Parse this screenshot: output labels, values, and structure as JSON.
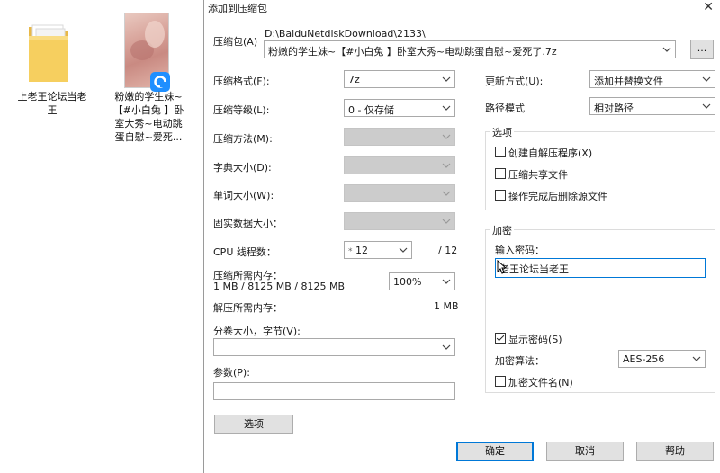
{
  "desktop": {
    "folder_label_line1": "上老王论坛当老",
    "folder_label_line2": "王",
    "file_label_line1": "粉嫩的学生妹~",
    "file_label_line2": "【#小白兔 】卧",
    "file_label_line3": "室大秀~电动跳",
    "file_label_line4": "蛋自慰~爱死..."
  },
  "dialog": {
    "title": "添加到压缩包",
    "close_glyph": "✕",
    "archive_label": "压缩包(A)",
    "archive_dir": "D:\\BaiduNetdiskDownload\\2133\\",
    "archive_name": "粉嫩的学生妹~【#小白兔 】卧室大秀~电动跳蛋自慰~爱死了.7z",
    "browse_label": "...",
    "format_label": "压缩格式(F):",
    "format_value": "7z",
    "level_label": "压缩等级(L):",
    "level_value": "0 - 仅存储",
    "method_label": "压缩方法(M):",
    "dict_label": "字典大小(D):",
    "word_label": "单词大小(W):",
    "solid_label": "固实数据大小：",
    "cpu_label": "CPU 线程数：",
    "cpu_value": "12",
    "cpu_total": "/ 12",
    "mem_comp_label": "压缩所需内存：",
    "mem_comp_value": "1 MB / 8125 MB / 8125 MB",
    "mem_percent": "100%",
    "mem_decomp_label": "解压所需内存：",
    "mem_decomp_value": "1 MB",
    "split_label": "分卷大小，字节(V):",
    "params_label": "参数(P):",
    "options_button": "选项",
    "update_label": "更新方式(U):",
    "update_value": "添加并替换文件",
    "path_label": "路径模式",
    "path_value": "相对路径",
    "options_group": "选项",
    "opt_sfx": "创建自解压程序(X)",
    "opt_shared": "压缩共享文件",
    "opt_delete": "操作完成后删除源文件",
    "encrypt_group": "加密",
    "password_label": "输入密码：",
    "password_value": "老王论坛当老王",
    "show_password": "显示密码(S)",
    "enc_method_label": "加密算法：",
    "enc_method_value": "AES-256",
    "enc_names": "加密文件名(N)",
    "ok": "确定",
    "cancel": "取消",
    "help": "帮助"
  },
  "colors": {
    "accent": "#0078d7",
    "disabled": "#cccccc",
    "button": "#e1e1e1"
  }
}
